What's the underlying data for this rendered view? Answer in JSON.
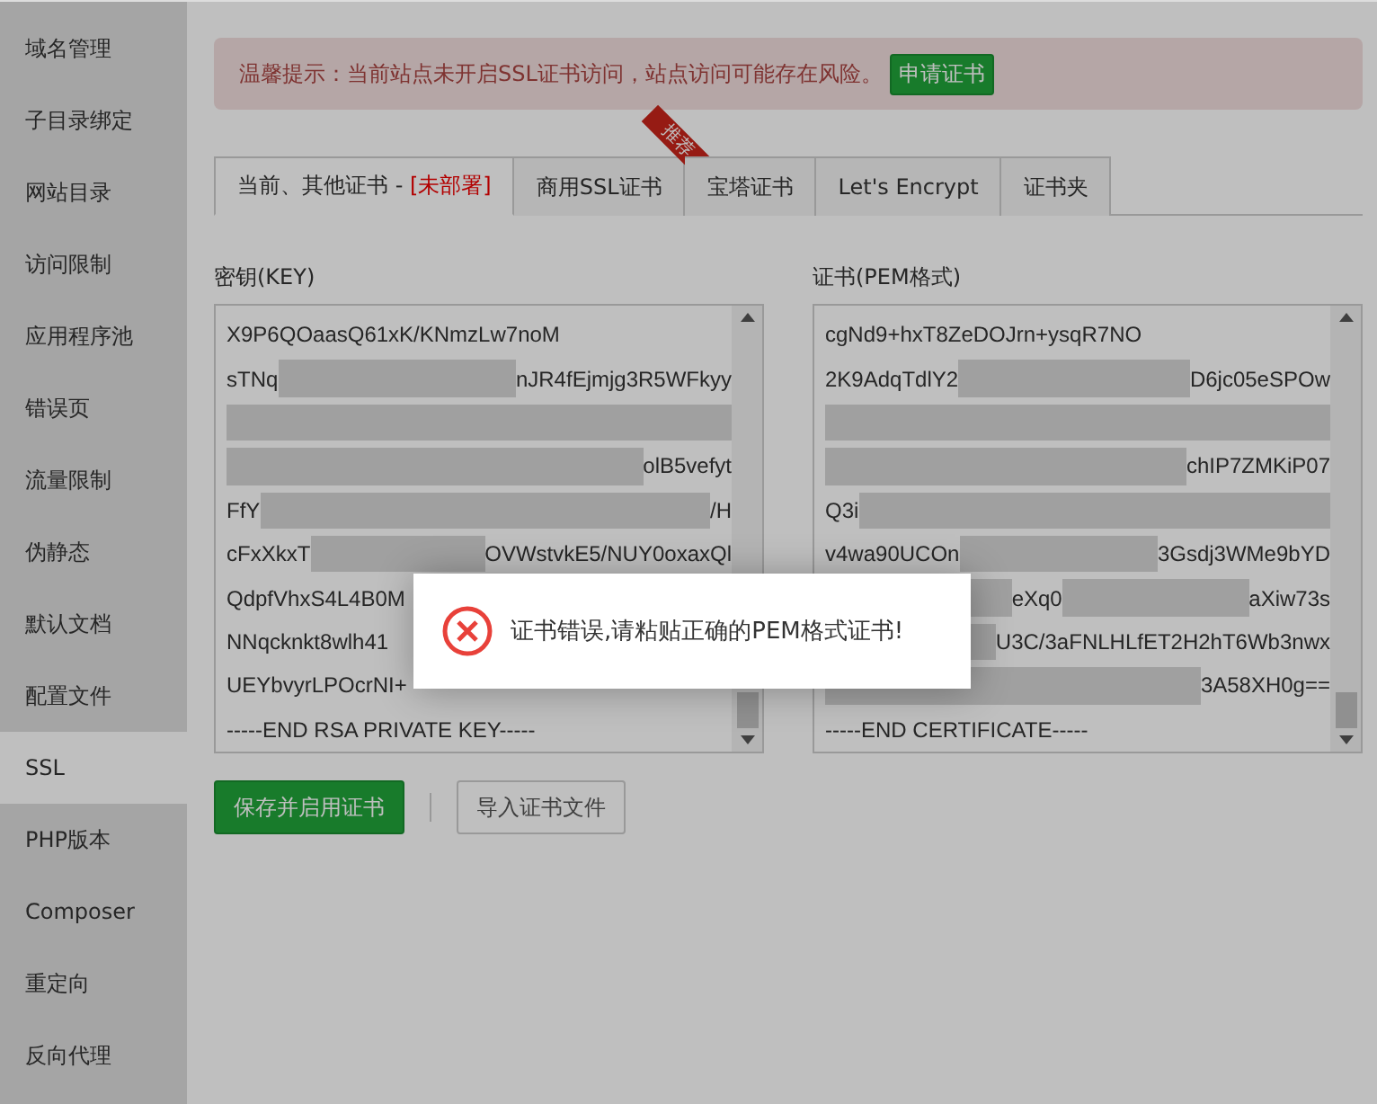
{
  "sidebar": {
    "items": [
      {
        "label": "域名管理",
        "selected": false
      },
      {
        "label": "子目录绑定",
        "selected": false
      },
      {
        "label": "网站目录",
        "selected": false
      },
      {
        "label": "访问限制",
        "selected": false
      },
      {
        "label": "应用程序池",
        "selected": false
      },
      {
        "label": "错误页",
        "selected": false
      },
      {
        "label": "流量限制",
        "selected": false
      },
      {
        "label": "伪静态",
        "selected": false
      },
      {
        "label": "默认文档",
        "selected": false
      },
      {
        "label": "配置文件",
        "selected": false
      },
      {
        "label": "SSL",
        "selected": true
      },
      {
        "label": "PHP版本",
        "selected": false
      },
      {
        "label": "Composer",
        "selected": false
      },
      {
        "label": "重定向",
        "selected": false
      },
      {
        "label": "反向代理",
        "selected": false
      }
    ]
  },
  "alert": {
    "text": "温馨提示：当前站点未开启SSL证书访问，站点访问可能存在风险。",
    "button": "申请证书"
  },
  "tabs": [
    {
      "label": "当前、其他证书 - ",
      "status": "[未部署]",
      "selected": true
    },
    {
      "label": "商用SSL证书",
      "ribbon": "推荐",
      "selected": false
    },
    {
      "label": "宝塔证书",
      "selected": false
    },
    {
      "label": "Let's Encrypt",
      "selected": false
    },
    {
      "label": "证书夹",
      "selected": false
    }
  ],
  "key": {
    "label": "密钥(KEY)",
    "lines": [
      [
        {
          "kind": "text",
          "text": "X9P6QOaasQ61xK/KNmzLw7noM"
        }
      ],
      [
        {
          "kind": "text",
          "text": "sTNq"
        },
        {
          "kind": "smear"
        },
        {
          "kind": "text",
          "text": "nJR4fEjmjg3R5WFkyy"
        }
      ],
      [
        {
          "kind": "smear"
        }
      ],
      [
        {
          "kind": "smear"
        },
        {
          "kind": "text",
          "text": "olB5vefyt"
        }
      ],
      [
        {
          "kind": "text",
          "text": "FfY"
        },
        {
          "kind": "smear"
        },
        {
          "kind": "text",
          "text": "/H"
        }
      ],
      [
        {
          "kind": "text",
          "text": "cFxXkxT"
        },
        {
          "kind": "smear"
        },
        {
          "kind": "text",
          "text": "OVWstvkE5/NUY0oxaxQl"
        }
      ],
      [
        {
          "kind": "text",
          "text": "QdpfVhxS4L4B0M"
        }
      ],
      [
        {
          "kind": "text",
          "text": "NNqcknkt8wlh41"
        }
      ],
      [
        {
          "kind": "text",
          "text": "UEYbvyrLPOcrNI+"
        }
      ],
      [
        {
          "kind": "text",
          "text": "-----END RSA PRIVATE KEY-----"
        }
      ]
    ]
  },
  "cert": {
    "label": "证书(PEM格式)",
    "lines": [
      [
        {
          "kind": "text",
          "text": "cgNd9+hxT8ZeDOJrn+ysqR7NO"
        }
      ],
      [
        {
          "kind": "text",
          "text": "2K9AdqTdlY2"
        },
        {
          "kind": "smear"
        },
        {
          "kind": "text",
          "text": "D6jc05eSPOw"
        }
      ],
      [
        {
          "kind": "smear"
        }
      ],
      [
        {
          "kind": "smear"
        },
        {
          "kind": "text",
          "text": "chIP7ZMKiP07"
        }
      ],
      [
        {
          "kind": "text",
          "text": "Q3i"
        },
        {
          "kind": "smear"
        }
      ],
      [
        {
          "kind": "text",
          "text": "v4wa90UCOn"
        },
        {
          "kind": "smear"
        },
        {
          "kind": "text",
          "text": "3Gsdj3WMe9bYD"
        }
      ],
      [
        {
          "kind": "smear"
        },
        {
          "kind": "text",
          "text": "eXq0"
        },
        {
          "kind": "smear"
        },
        {
          "kind": "text",
          "text": "aXiw73s"
        }
      ],
      [
        {
          "kind": "smear"
        },
        {
          "kind": "text",
          "text": "U3C/3aFNLHLfET2H2hT6Wb3nwx"
        }
      ],
      [
        {
          "kind": "smear"
        },
        {
          "kind": "text",
          "text": "3A58XH0g=="
        }
      ],
      [
        {
          "kind": "text",
          "text": "-----END CERTIFICATE-----"
        }
      ]
    ]
  },
  "buttons": {
    "save": "保存并启用证书",
    "import": "导入证书文件"
  },
  "dialog": {
    "message": "证书错误,请粘贴正确的PEM格式证书!"
  }
}
